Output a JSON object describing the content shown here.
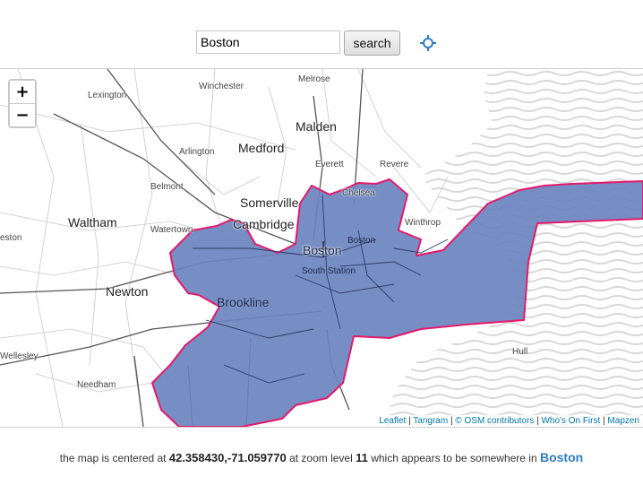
{
  "search": {
    "value": "Boston",
    "button_label": "search",
    "locate_icon": "crosshair-icon"
  },
  "map": {
    "zoom_in": "+",
    "zoom_out": "−",
    "labels": {
      "lexington": "Lexington",
      "winchester": "Winchester",
      "melrose": "Melrose",
      "malden": "Malden",
      "medford": "Medford",
      "arlington": "Arlington",
      "everett": "Everett",
      "revere": "Revere",
      "belmont": "Belmont",
      "somerville": "Somerville",
      "chelsea": "Chelsea",
      "winthrop": "Winthrop",
      "waltham": "Waltham",
      "watertown": "Watertown",
      "cambridge": "Cambridge",
      "boston_center": "Boston",
      "boston_east": "Boston",
      "weston": "eston",
      "south_station": "South Station",
      "newton": "Newton",
      "brookline": "Brookline",
      "wellesley": "Wellesley",
      "needham": "Needham",
      "hull": "Hull"
    },
    "highlight_fill": "#6b84bf",
    "highlight_stroke": "#e6186b"
  },
  "attribution": {
    "leaflet": "Leaflet",
    "tangram": "Tangram",
    "osm": "© OSM contributors",
    "wof": "Who's On First",
    "mapzen": "Mapzen"
  },
  "status": {
    "prefix": "the map is centered at",
    "coords": "42.358430,-71.059770",
    "middle": "at zoom level",
    "zoom": "11",
    "suffix": "which appears to be somewhere in",
    "place": "Boston"
  }
}
